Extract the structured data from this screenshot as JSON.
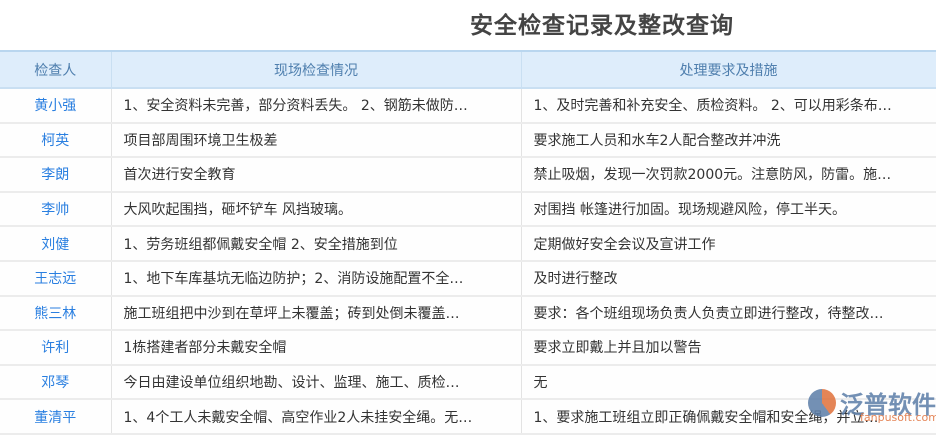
{
  "title": "安全检查记录及整改查询",
  "columns": [
    "检查人",
    "现场检查情况",
    "处理要求及措施"
  ],
  "rows": [
    {
      "inspector": "黄小强",
      "situation": "1、安全资料未完善，部分资料丢失。 2、钢筋未做防…",
      "measures": "1、及时完善和补充安全、质检资料。 2、可以用彩条布…"
    },
    {
      "inspector": "柯英",
      "situation": "项目部周围环境卫生极差",
      "measures": "要求施工人员和水车2人配合整改并冲洗"
    },
    {
      "inspector": "李朗",
      "situation": "首次进行安全教育",
      "measures": "禁止吸烟，发现一次罚款2000元。注意防风，防雷。施…"
    },
    {
      "inspector": "李帅",
      "situation": "大风吹起围挡，砸坏铲车 风挡玻璃。",
      "measures": "对围挡 帐篷进行加固。现场规避风险，停工半天。"
    },
    {
      "inspector": "刘健",
      "situation": "1、劳务班组都佩戴安全帽 2、安全措施到位",
      "measures": "定期做好安全会议及宣讲工作"
    },
    {
      "inspector": "王志远",
      "situation": "1、地下车库基坑无临边防护；2、消防设施配置不全…",
      "measures": "及时进行整改"
    },
    {
      "inspector": "熊三林",
      "situation": "施工班组把中沙到在草坪上未覆盖；砖到处倒未覆盖…",
      "measures": "要求：各个班组现场负责人负责立即进行整改，待整改…"
    },
    {
      "inspector": "许利",
      "situation": "1栋搭建者部分未戴安全帽",
      "measures": "要求立即戴上并且加以警告"
    },
    {
      "inspector": "邓琴",
      "situation": "今日由建设单位组织地勘、设计、监理、施工、质检…",
      "measures": "无"
    },
    {
      "inspector": "董清平",
      "situation": "1、4个工人未戴安全帽、高空作业2人未挂安全绳。无…",
      "measures": "1、要求施工班组立即正确佩戴安全帽和安全绳，并立…"
    }
  ],
  "watermark": {
    "brand": "泛普软件",
    "url": "fanpusoft.com"
  }
}
